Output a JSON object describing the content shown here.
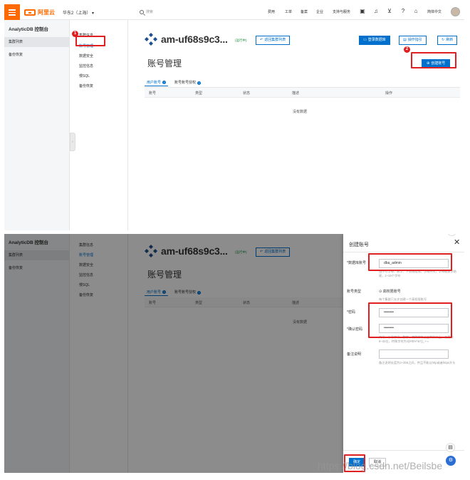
{
  "topbar": {
    "logo_text": "阿里云",
    "region": "华东2（上海）",
    "search_placeholder": "搜索",
    "nav": [
      "费用",
      "工单",
      "备案",
      "企业",
      "支持与服务"
    ],
    "lang": "简体中文"
  },
  "sidebar": {
    "title": "AnalyticDB 控制台",
    "items": [
      "集群列表",
      "备份恢复"
    ]
  },
  "subnav": {
    "items": [
      "集群信息",
      "账号管理",
      "数据安全",
      "监控信息",
      "慢SQL",
      "备份恢复"
    ]
  },
  "cluster": {
    "name": "am-uf68s9c3...",
    "status": "(运行中)",
    "back_button": "返回集群列表"
  },
  "header_actions": {
    "login_db": "登录数据库",
    "op_guide": "操作指引",
    "refresh": "刷新"
  },
  "page": {
    "title": "账号管理",
    "create_button": "创建账号",
    "tabs": [
      "用户账号",
      "账号账号授权"
    ],
    "columns": [
      "账号",
      "类型",
      "状态",
      "描述",
      "操作"
    ],
    "empty_text": "没有数据"
  },
  "annotations": [
    "1",
    "2"
  ],
  "drawer": {
    "title": "创建账号",
    "fields": {
      "account_label": "*数据库账号",
      "account_value": "dba_admin",
      "account_hint": "由小写字母、数字、下划线组成，字母开头，字母或数字结尾，2~16个字符",
      "type_label": "账号类型",
      "type_value": "高权限账号",
      "type_hint": "每个集群只允许创建一个高权限账号",
      "password_label": "*密码",
      "password_value": "••••••••",
      "confirm_label": "*确认密码",
      "confirm_value": "••••••••",
      "password_hint": "大写、小写字母、数字、特殊字符占三种及以上，长度为8~32位，特殊字符为!@#$%^&*()_+-=",
      "remark_label": "备注说明",
      "remark_hint": "备注说明长度为2~256之间，并且不能以http或者https开头"
    },
    "ok_button": "确定",
    "cancel_button": "取消"
  },
  "watermark": "https://blog.csdn.net/Beilsbe"
}
